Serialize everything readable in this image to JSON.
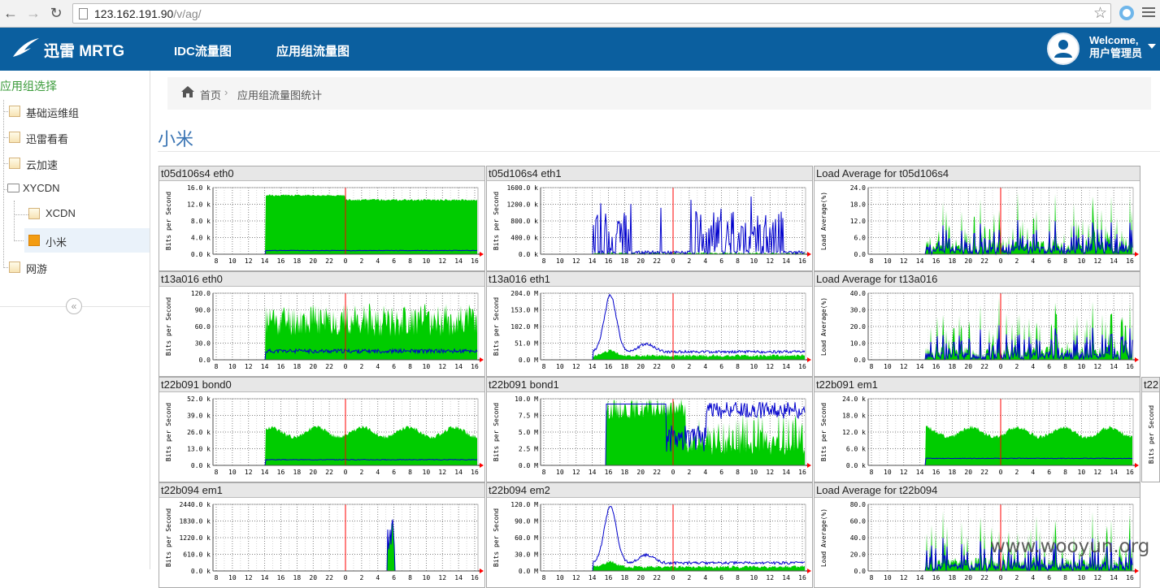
{
  "browser": {
    "url_host": "123.162.191.90",
    "url_path": "/v/ag/"
  },
  "header": {
    "brand": "迅雷 MRTG",
    "nav": [
      "IDC流量图",
      "应用组流量图"
    ],
    "user_welcome": "Welcome,",
    "user_name": "用户管理员"
  },
  "sidebar": {
    "title": "应用组选择",
    "items": [
      {
        "label": "基础运维组"
      },
      {
        "label": "迅雷看看"
      },
      {
        "label": "云加速"
      },
      {
        "label": "XYCDN"
      },
      {
        "label": "XCDN"
      },
      {
        "label": "小米"
      },
      {
        "label": "网游"
      }
    ],
    "collapse_glyph": "«"
  },
  "breadcrumb": {
    "home": "首页",
    "separator": "›",
    "current": "应用组流量图统计"
  },
  "page_title": "小米",
  "x_ticks": [
    "8",
    "10",
    "12",
    "14",
    "16",
    "18",
    "20",
    "22",
    "0",
    "2",
    "4",
    "6",
    "8",
    "10",
    "12",
    "14",
    "16"
  ],
  "colors": {
    "header_bg": "#0b5f9f",
    "in_fill": "#00cc00",
    "out_line": "#0000cc",
    "now_line": "#ff0000"
  },
  "graphs": [
    {
      "title": "t05d106s4 eth0",
      "ylabel": "Bits per Second",
      "yticks": [
        "16.0 k",
        "12.0 k",
        "8.0 k",
        "4.0 k",
        "0.0 k"
      ],
      "ymax": 16,
      "kind": "plateau",
      "green_level": 0.9,
      "blue_level": 0.05,
      "start": 0.2
    },
    {
      "title": "t05d106s4 eth1",
      "ylabel": "Bits per Second",
      "yticks": [
        "1600.0 k",
        "1200.0 k",
        "800.0 k",
        "400.0 k",
        "0.0 k"
      ],
      "ymax": 1600,
      "kind": "bluespiky",
      "green_level": 0.02,
      "blue_level": 0.3,
      "start": 0.2
    },
    {
      "title": "Load Average for t05d106s4",
      "ylabel": "Load Average(%)",
      "yticks": [
        "24.0",
        "18.0",
        "12.0",
        "6.0",
        "0.0"
      ],
      "ymax": 24,
      "kind": "load",
      "green_level": 0.3,
      "blue_level": 0.15,
      "start": 0.22
    },
    {
      "title": "t13a016 eth0",
      "ylabel": "Bits per Second",
      "yticks": [
        "120.0",
        "90.0",
        "60.0",
        "30.0",
        "0.0"
      ],
      "ymax": 120,
      "kind": "noisy",
      "green_level": 0.55,
      "blue_level": 0.12,
      "start": 0.2
    },
    {
      "title": "t13a016 eth1",
      "ylabel": "Bits per Second",
      "yticks": [
        "204.0 M",
        "153.0 M",
        "102.0 M",
        "51.0 M",
        "0.0 M"
      ],
      "ymax": 204,
      "kind": "peak",
      "green_level": 0.05,
      "blue_level": 0.1,
      "start": 0.2
    },
    {
      "title": "Load Average for t13a016",
      "ylabel": "Load Average(%)",
      "yticks": [
        "40.0",
        "30.0",
        "20.0",
        "10.0",
        "0.0"
      ],
      "ymax": 40,
      "kind": "load",
      "green_level": 0.2,
      "blue_level": 0.1,
      "start": 0.22
    },
    {
      "title": "t22b091 bond0",
      "ylabel": "Bits per Second",
      "yticks": [
        "52.0 k",
        "39.0 k",
        "26.0 k",
        "13.0 k",
        "0.0 k"
      ],
      "ymax": 52,
      "kind": "plateau",
      "green_level": 0.6,
      "blue_level": 0.08,
      "start": 0.2
    },
    {
      "title": "t22b091 bond1",
      "ylabel": "Bits per Second",
      "yticks": [
        "10.0 M",
        "7.5 M",
        "5.0 M",
        "2.5 M",
        "0.0 M"
      ],
      "ymax": 10,
      "kind": "blocky",
      "green_level": 0.8,
      "blue_level": 0.9,
      "start": 0.25
    },
    {
      "title": "t22b091 em1",
      "ylabel": "Bits per Second",
      "yticks": [
        "24.0 k",
        "18.0 k",
        "12.0 k",
        "6.0 k",
        "0.0 k"
      ],
      "ymax": 24,
      "kind": "plateau",
      "green_level": 0.6,
      "blue_level": 0.1,
      "start": 0.22
    },
    {
      "title": "t22b094 em1",
      "ylabel": "Bits per Second",
      "yticks": [
        "2440.0 k",
        "1830.0 k",
        "1220.0 k",
        "610.0 k",
        "0.0 k"
      ],
      "ymax": 2440,
      "kind": "spike",
      "green_level": 0.0,
      "blue_level": 0.0,
      "start": 0.66
    },
    {
      "title": "t22b094 em2",
      "ylabel": "Bits per Second",
      "yticks": [
        "120.0 M",
        "90.0 M",
        "60.0 M",
        "30.0 M",
        "0.0 M"
      ],
      "ymax": 120,
      "kind": "peak",
      "green_level": 0.05,
      "blue_level": 0.1,
      "start": 0.2
    },
    {
      "title": "Load Average for t22b094",
      "ylabel": "Load Average(%)",
      "yticks": [
        "80.0",
        "60.0",
        "40.0",
        "20.0",
        "0.0"
      ],
      "ymax": 80,
      "kind": "load",
      "green_level": 0.25,
      "blue_level": 0.12,
      "start": 0.22
    }
  ],
  "partial_graph": {
    "title": "t22",
    "ylabel": "Bits per Second"
  },
  "watermark": "www.wooyun.org"
}
